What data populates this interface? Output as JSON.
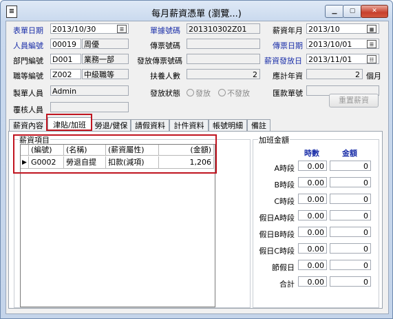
{
  "window": {
    "title": "每月薪資憑單 (瀏覽...)",
    "app_icon": "document-icon"
  },
  "header": {
    "voucher_date_label": "表單日期",
    "voucher_date": "2013/10/30",
    "voucher_no_label": "單據號碼",
    "voucher_no": "201310302Z01",
    "salary_month_label": "薪資年月",
    "salary_month": "2013/10",
    "employee_no_label": "人員編號",
    "employee_no": "00019",
    "employee_name": "周優",
    "receipt_no_label": "傳票號碼",
    "receipt_no": "",
    "receipt_date_label": "傳票日期",
    "receipt_date": "2013/10/01",
    "dept_no_label": "部門編號",
    "dept_no": "D001",
    "dept_name": "業務一部",
    "pay_receipt_no_label": "發放傳票號碼",
    "pay_receipt_no": "",
    "pay_date_label": "薪資發放日",
    "pay_date": "2013/11/01",
    "grade_no_label": "職等編號",
    "grade_no": "Z002",
    "grade_name": "中級職等",
    "dependents_label": "扶養人數",
    "dependents": "2",
    "tenure_label": "應計年資",
    "tenure": "2",
    "tenure_unit": "個月",
    "creator_label": "製單人員",
    "creator": "Admin",
    "pay_status_label": "發放狀態",
    "status_paid": "發放",
    "status_unpaid": "不發放",
    "remit_no_label": "匯款單號",
    "remit_no": "",
    "reviewer_label": "覆核人員",
    "reviewer": ""
  },
  "toolbar": {
    "reset_label": "重置薪資"
  },
  "tabs": [
    "薪資內容",
    "津貼/加班",
    "勞退/健保",
    "請假資料",
    "計件資料",
    "帳號明細",
    "備註"
  ],
  "items_group": {
    "title": "薪資項目",
    "columns": [
      "(編號)",
      "(名稱)",
      "(薪資屬性)",
      "(金額)"
    ],
    "rows": [
      {
        "code": "G0002",
        "name": "勞退自提",
        "attr": "扣款(減項)",
        "amount": "1,206"
      }
    ]
  },
  "overtime": {
    "title": "加班金額",
    "hours_header": "時數",
    "amount_header": "金額",
    "rows": [
      {
        "label": "A時段",
        "hours": "0.00",
        "amount": "0"
      },
      {
        "label": "B時段",
        "hours": "0.00",
        "amount": "0"
      },
      {
        "label": "C時段",
        "hours": "0.00",
        "amount": "0"
      },
      {
        "label": "假日A時段",
        "hours": "0.00",
        "amount": "0"
      },
      {
        "label": "假日B時段",
        "hours": "0.00",
        "amount": "0"
      },
      {
        "label": "假日C時段",
        "hours": "0.00",
        "amount": "0"
      },
      {
        "label": "節假日",
        "hours": "0.00",
        "amount": "0"
      },
      {
        "label": "合計",
        "hours": "0.00",
        "amount": "0"
      }
    ]
  }
}
